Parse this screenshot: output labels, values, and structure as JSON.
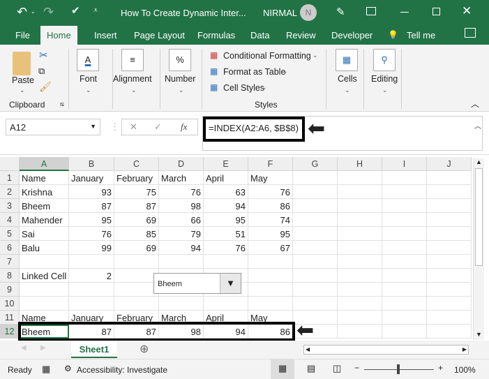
{
  "title": {
    "doc": "How To Create Dynamic Inter...",
    "user": "NIRMAL",
    "avatar": "N"
  },
  "tabs": [
    "File",
    "Home",
    "Insert",
    "Page Layout",
    "Formulas",
    "Data",
    "Review",
    "Developer",
    "Tell me"
  ],
  "ribbon": {
    "paste": "Paste",
    "clipboard": "Clipboard",
    "font": "Font",
    "alignment": "Alignment",
    "number": "Number",
    "cond": "Conditional Formatting",
    "table": "Format as Table",
    "styles_btn": "Cell Styles",
    "styles": "Styles",
    "cells": "Cells",
    "editing": "Editing"
  },
  "formula": {
    "namebox": "A12",
    "fx": "fx",
    "value": "=INDEX(A2:A6, $B$8)"
  },
  "columns": [
    "A",
    "B",
    "C",
    "D",
    "E",
    "F",
    "G",
    "H",
    "I",
    "J"
  ],
  "rows": [
    [
      "Name",
      "January",
      "February",
      "March",
      "April",
      "May"
    ],
    [
      "Krishna",
      "93",
      "75",
      "76",
      "63",
      "76"
    ],
    [
      "Bheem",
      "87",
      "87",
      "98",
      "94",
      "86"
    ],
    [
      "Mahender",
      "95",
      "69",
      "66",
      "95",
      "74"
    ],
    [
      "Sai",
      "76",
      "85",
      "79",
      "51",
      "95"
    ],
    [
      "Balu",
      "99",
      "69",
      "94",
      "76",
      "67"
    ],
    [],
    [
      "Linked Cell",
      "2"
    ],
    [],
    [],
    [
      "Name",
      "January",
      "February",
      "March",
      "April",
      "May"
    ],
    [
      "Bheem",
      "87",
      "87",
      "98",
      "94",
      "86"
    ]
  ],
  "combobox": {
    "value": "Bheem"
  },
  "sheet": "Sheet1",
  "status": {
    "ready": "Ready",
    "accessibility": "Accessibility: Investigate",
    "zoom": "100%"
  }
}
